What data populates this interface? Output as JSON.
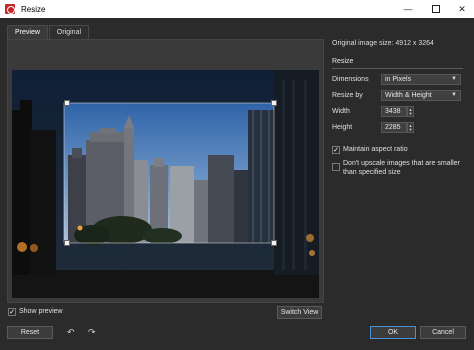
{
  "window": {
    "title": "Resize",
    "min_glyph": "—",
    "close_glyph": "✕"
  },
  "tabs": [
    {
      "label": "Preview",
      "active": true
    },
    {
      "label": "Original",
      "active": false
    }
  ],
  "info": {
    "original_size": "Original image size: 4912 x 3264"
  },
  "resize": {
    "section_title": "Resize",
    "dimensions_label": "Dimensions",
    "dimensions_value": "in Pixels",
    "resize_by_label": "Resize by",
    "resize_by_value": "Width & Height",
    "width_label": "Width",
    "width_value": "3438",
    "height_label": "Height",
    "height_value": "2285",
    "maintain_aspect_label": "Maintain aspect ratio",
    "maintain_aspect_checked": true,
    "no_upscale_label_1": "Don't upscale images that are smaller",
    "no_upscale_label_2": "than specified size",
    "no_upscale_checked": false
  },
  "preview_controls": {
    "show_preview_label": "Show preview",
    "show_preview_checked": true,
    "switch_view_label": "Switch View"
  },
  "footer": {
    "reset_label": "Reset",
    "undo_glyph": "↶",
    "redo_glyph": "↷",
    "ok_label": "OK",
    "cancel_label": "Cancel"
  },
  "check_glyph": "✓",
  "dropdown_glyph": "▼",
  "spin_up_glyph": "▲",
  "spin_down_glyph": "▼",
  "colors": {
    "accent": "#4a90d9",
    "background": "#2b2b2b",
    "brand_icon": "#c62828"
  }
}
